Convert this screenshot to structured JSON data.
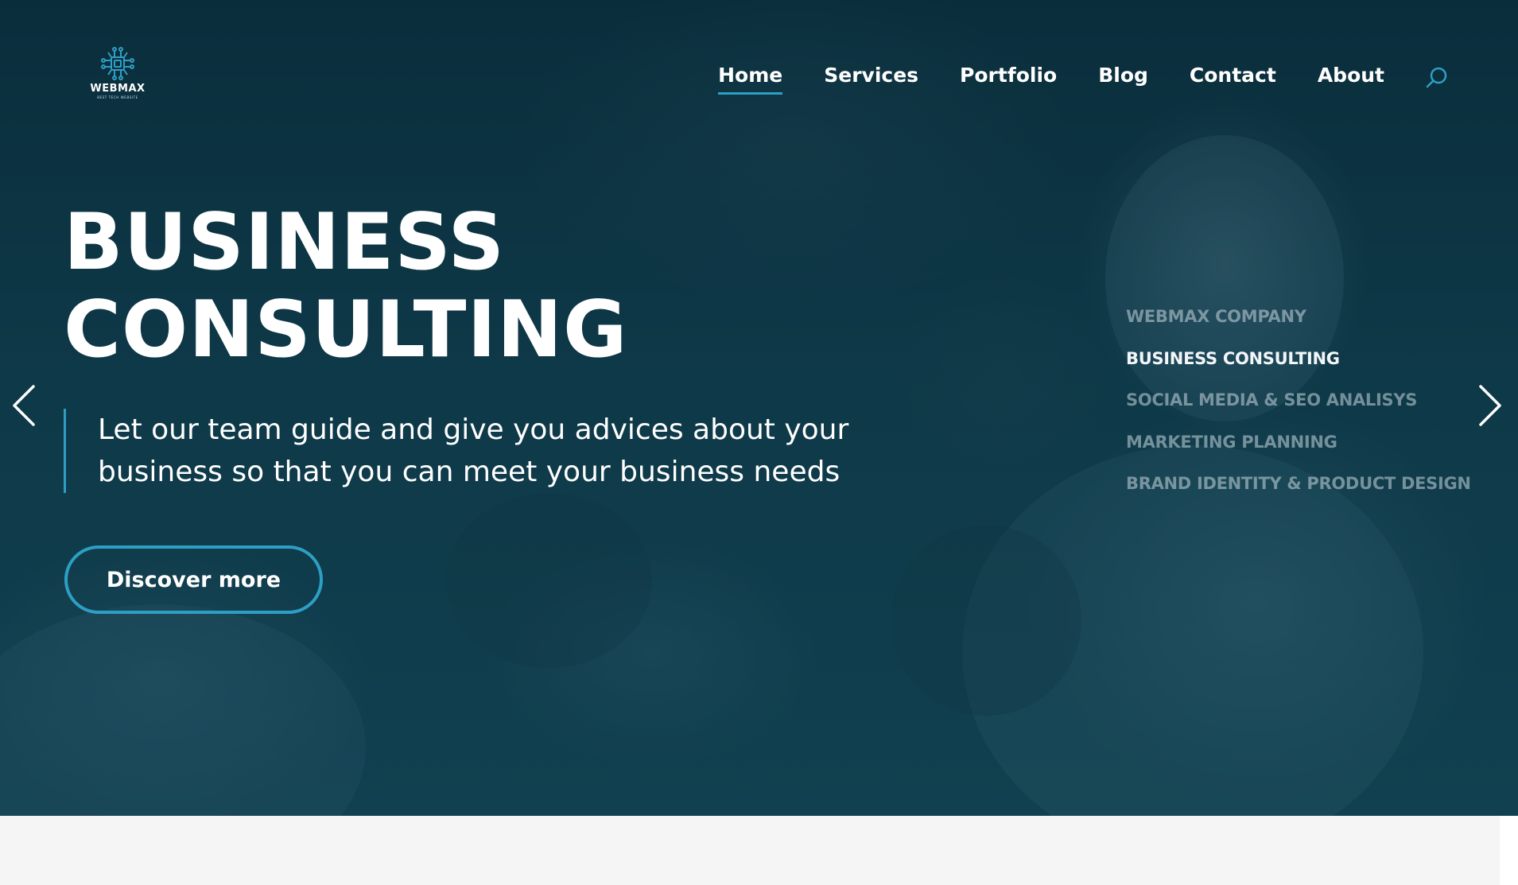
{
  "brand": {
    "name": "WEBMAX",
    "tagline": "BEST TECH WEBSITE",
    "logo_icon": "circuit-chip-icon",
    "accent_color": "#2e9fc4"
  },
  "nav": {
    "items": [
      {
        "label": "Home",
        "active": true
      },
      {
        "label": "Services",
        "active": false
      },
      {
        "label": "Portfolio",
        "active": false
      },
      {
        "label": "Blog",
        "active": false
      },
      {
        "label": "Contact",
        "active": false
      },
      {
        "label": "About",
        "active": false
      }
    ],
    "search_icon": "search-icon"
  },
  "hero": {
    "title_line1": "BUSINESS",
    "title_line2": "CONSULTING",
    "subtitle": "Let our team guide and give you advices about your business so that you can meet your business needs",
    "cta_label": "Discover more",
    "prev_icon": "chevron-left-icon",
    "next_icon": "chevron-right-icon"
  },
  "slides": {
    "items": [
      {
        "label": "WEBMAX COMPANY",
        "active": false
      },
      {
        "label": "BUSINESS CONSULTING",
        "active": true
      },
      {
        "label": "SOCIAL MEDIA & SEO ANALISYS",
        "active": false
      },
      {
        "label": "MARKETING PLANNING",
        "active": false
      },
      {
        "label": "BRAND IDENTITY & PRODUCT DESIGN",
        "active": false
      }
    ]
  }
}
